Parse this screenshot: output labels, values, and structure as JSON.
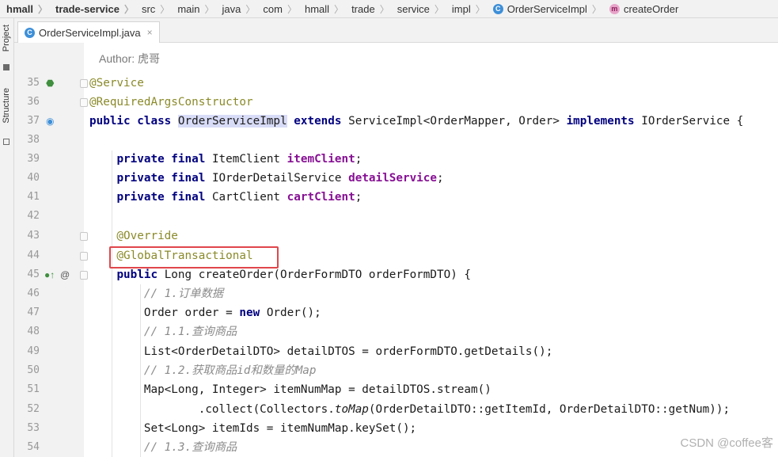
{
  "breadcrumb": [
    {
      "label": "hmall",
      "bold": true
    },
    {
      "label": "trade-service",
      "bold": true
    },
    {
      "label": "src"
    },
    {
      "label": "main"
    },
    {
      "label": "java"
    },
    {
      "label": "com"
    },
    {
      "label": "hmall"
    },
    {
      "label": "trade"
    },
    {
      "label": "service"
    },
    {
      "label": "impl"
    },
    {
      "label": "OrderServiceImpl",
      "icon": "class-icon"
    },
    {
      "label": "createOrder",
      "icon": "method-icon"
    }
  ],
  "side_tabs": {
    "project": "Project",
    "structure": "Structure"
  },
  "editor_tab": {
    "label": "OrderServiceImpl.java",
    "close": "×"
  },
  "author_hint": "Author: 虎哥",
  "code_lines": [
    {
      "n": "35",
      "text": "@Service"
    },
    {
      "n": "36",
      "text": "@RequiredArgsConstructor"
    },
    {
      "n": "37",
      "text": "public class OrderServiceImpl extends ServiceImpl<OrderMapper, Order> implements IOrderService {"
    },
    {
      "n": "38",
      "text": ""
    },
    {
      "n": "39",
      "text": "    private final ItemClient itemClient;"
    },
    {
      "n": "40",
      "text": "    private final IOrderDetailService detailService;"
    },
    {
      "n": "41",
      "text": "    private final CartClient cartClient;"
    },
    {
      "n": "42",
      "text": ""
    },
    {
      "n": "43",
      "text": "    @Override"
    },
    {
      "n": "44",
      "text": "    @GlobalTransactional"
    },
    {
      "n": "45",
      "text": "    public Long createOrder(OrderFormDTO orderFormDTO) {"
    },
    {
      "n": "46",
      "text": "        // 1.订单数据"
    },
    {
      "n": "47",
      "text": "        Order order = new Order();"
    },
    {
      "n": "48",
      "text": "        // 1.1.查询商品"
    },
    {
      "n": "49",
      "text": "        List<OrderDetailDTO> detailDTOS = orderFormDTO.getDetails();"
    },
    {
      "n": "50",
      "text": "        // 1.2.获取商品id和数量的Map"
    },
    {
      "n": "51",
      "text": "        Map<Long, Integer> itemNumMap = detailDTOS.stream()"
    },
    {
      "n": "52",
      "text": "                .collect(Collectors.toMap(OrderDetailDTO::getItemId, OrderDetailDTO::getNum));"
    },
    {
      "n": "53",
      "text": "        Set<Long> itemIds = itemNumMap.keySet();"
    },
    {
      "n": "54",
      "text": "        // 1.3.查询商品"
    }
  ],
  "watermark": "CSDN @coffee客",
  "colors": {
    "keyword": "#000080",
    "annotation": "#8a8a2a",
    "field": "#871094",
    "comment": "#8c8c8c",
    "highlight_box": "#e0464b"
  }
}
